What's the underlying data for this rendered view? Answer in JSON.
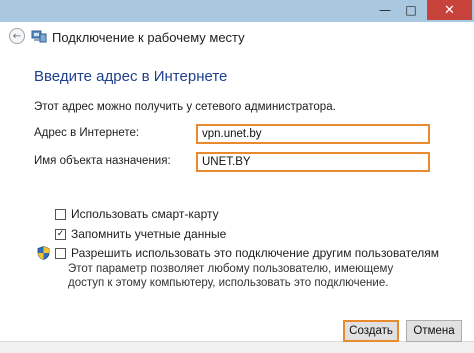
{
  "window": {
    "title": "Подключение к рабочему месту"
  },
  "titlebar": {
    "minimize": "—",
    "maximize": "□",
    "close": "✕"
  },
  "page": {
    "heading": "Введите адрес в Интернете",
    "description": "Этот адрес можно получить у сетевого администратора."
  },
  "form": {
    "address_label": "Адрес в Интернете:",
    "address_value": "vpn.unet.by",
    "name_label": "Имя объекта назначения:",
    "name_value": "UNET.BY"
  },
  "options": {
    "smart_card": {
      "label": "Использовать смарт-карту",
      "checked": false
    },
    "remember": {
      "label": "Запомнить учетные данные",
      "checked": true
    },
    "share": {
      "label": "Разрешить использовать это подключение другим пользователям",
      "checked": false
    }
  },
  "note": "Этот параметр позволяет любому пользователю, имеющему доступ к этому компьютеру, использовать это подключение.",
  "buttons": {
    "create": "Создать",
    "cancel": "Отмена"
  },
  "icons": {
    "back": "back-arrow-icon",
    "app": "network-icon",
    "shield": "uac-shield-icon"
  },
  "colors": {
    "title_text": "#1f3f8f",
    "highlight": "#e88a2e",
    "close_button": "#c7423a"
  }
}
